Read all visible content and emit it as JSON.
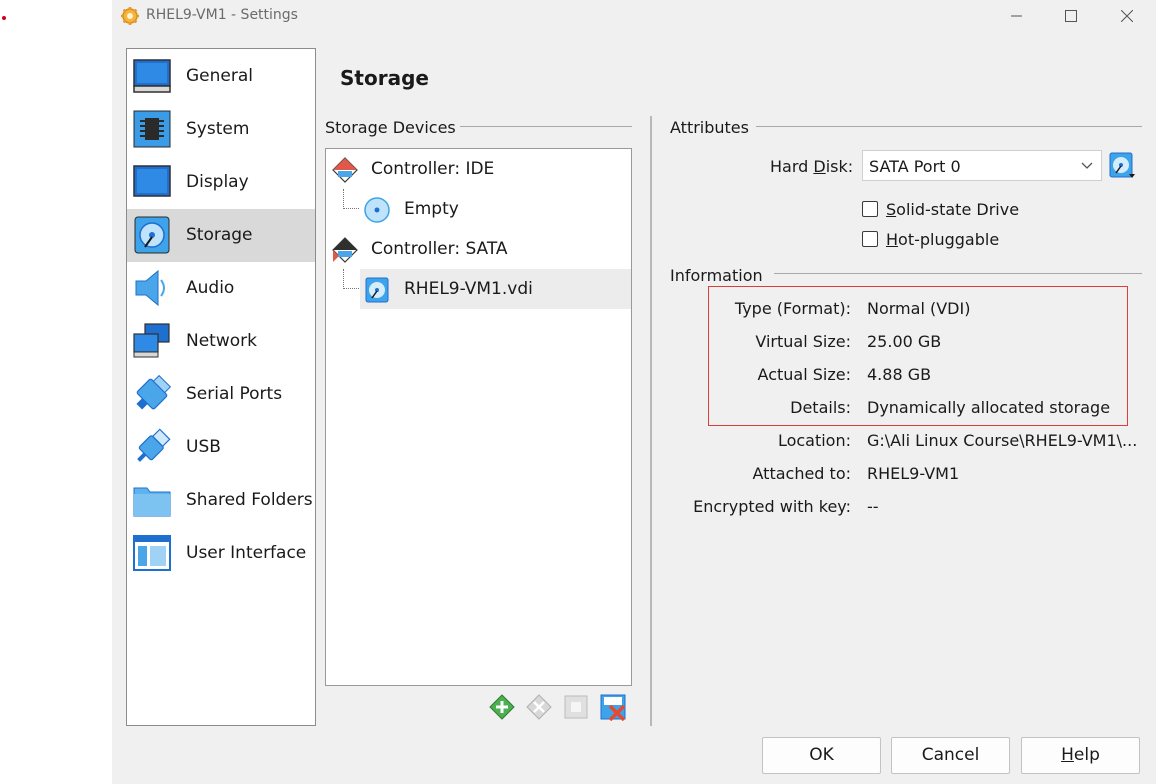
{
  "window": {
    "title": "RHEL9-VM1 - Settings"
  },
  "sidebar": {
    "items": [
      {
        "label": "General"
      },
      {
        "label": "System"
      },
      {
        "label": "Display"
      },
      {
        "label": "Storage"
      },
      {
        "label": "Audio"
      },
      {
        "label": "Network"
      },
      {
        "label": "Serial Ports"
      },
      {
        "label": "USB"
      },
      {
        "label": "Shared Folders"
      },
      {
        "label": "User Interface"
      }
    ],
    "active_index": 3
  },
  "page": {
    "title": "Storage"
  },
  "storage_devices": {
    "label": "Storage Devices",
    "tree": [
      {
        "label": "Controller: IDE"
      },
      {
        "label": "Empty"
      },
      {
        "label": "Controller: SATA"
      },
      {
        "label": "RHEL9-VM1.vdi"
      }
    ]
  },
  "attributes": {
    "label": "Attributes",
    "hard_disk_label_pre": "Hard ",
    "hard_disk_label_mn": "D",
    "hard_disk_label_post": "isk:",
    "hard_disk_value": "SATA Port 0",
    "ssd_mn": "S",
    "ssd_rest": "olid-state Drive",
    "ssd_checked": false,
    "hotplug_mn": "H",
    "hotplug_rest": "ot-pluggable",
    "hotplug_checked": false
  },
  "information": {
    "label": "Information",
    "rows": [
      {
        "key": "Type (Format):",
        "value": "Normal (VDI)"
      },
      {
        "key": "Virtual Size:",
        "value": "25.00 GB"
      },
      {
        "key": "Actual Size:",
        "value": "4.88 GB"
      },
      {
        "key": "Details:",
        "value": "Dynamically allocated storage"
      },
      {
        "key": "Location:",
        "value": "G:\\Ali Linux Course\\RHEL9-VM1\\..."
      },
      {
        "key": "Attached to:",
        "value": "RHEL9-VM1"
      },
      {
        "key": "Encrypted with key:",
        "value": "--"
      }
    ]
  },
  "buttons": {
    "ok": "OK",
    "cancel": "Cancel",
    "help_mn": "H",
    "help_rest": "elp"
  },
  "colors": {
    "accent_blue": "#1e7fd6",
    "highlight_red": "#d9403a",
    "selected_bg": "#d9d9d9"
  },
  "icons": {
    "title": "settings-gear-icon",
    "sidebar": [
      "monitor-icon",
      "chip-icon",
      "display-icon",
      "storage-disk-icon",
      "speaker-icon",
      "network-icon",
      "serial-port-icon",
      "usb-icon",
      "folder-icon",
      "user-interface-icon"
    ],
    "toolbar": [
      "add-attachment-icon",
      "remove-attachment-icon",
      "add-controller-icon",
      "remove-controller-icon"
    ]
  }
}
